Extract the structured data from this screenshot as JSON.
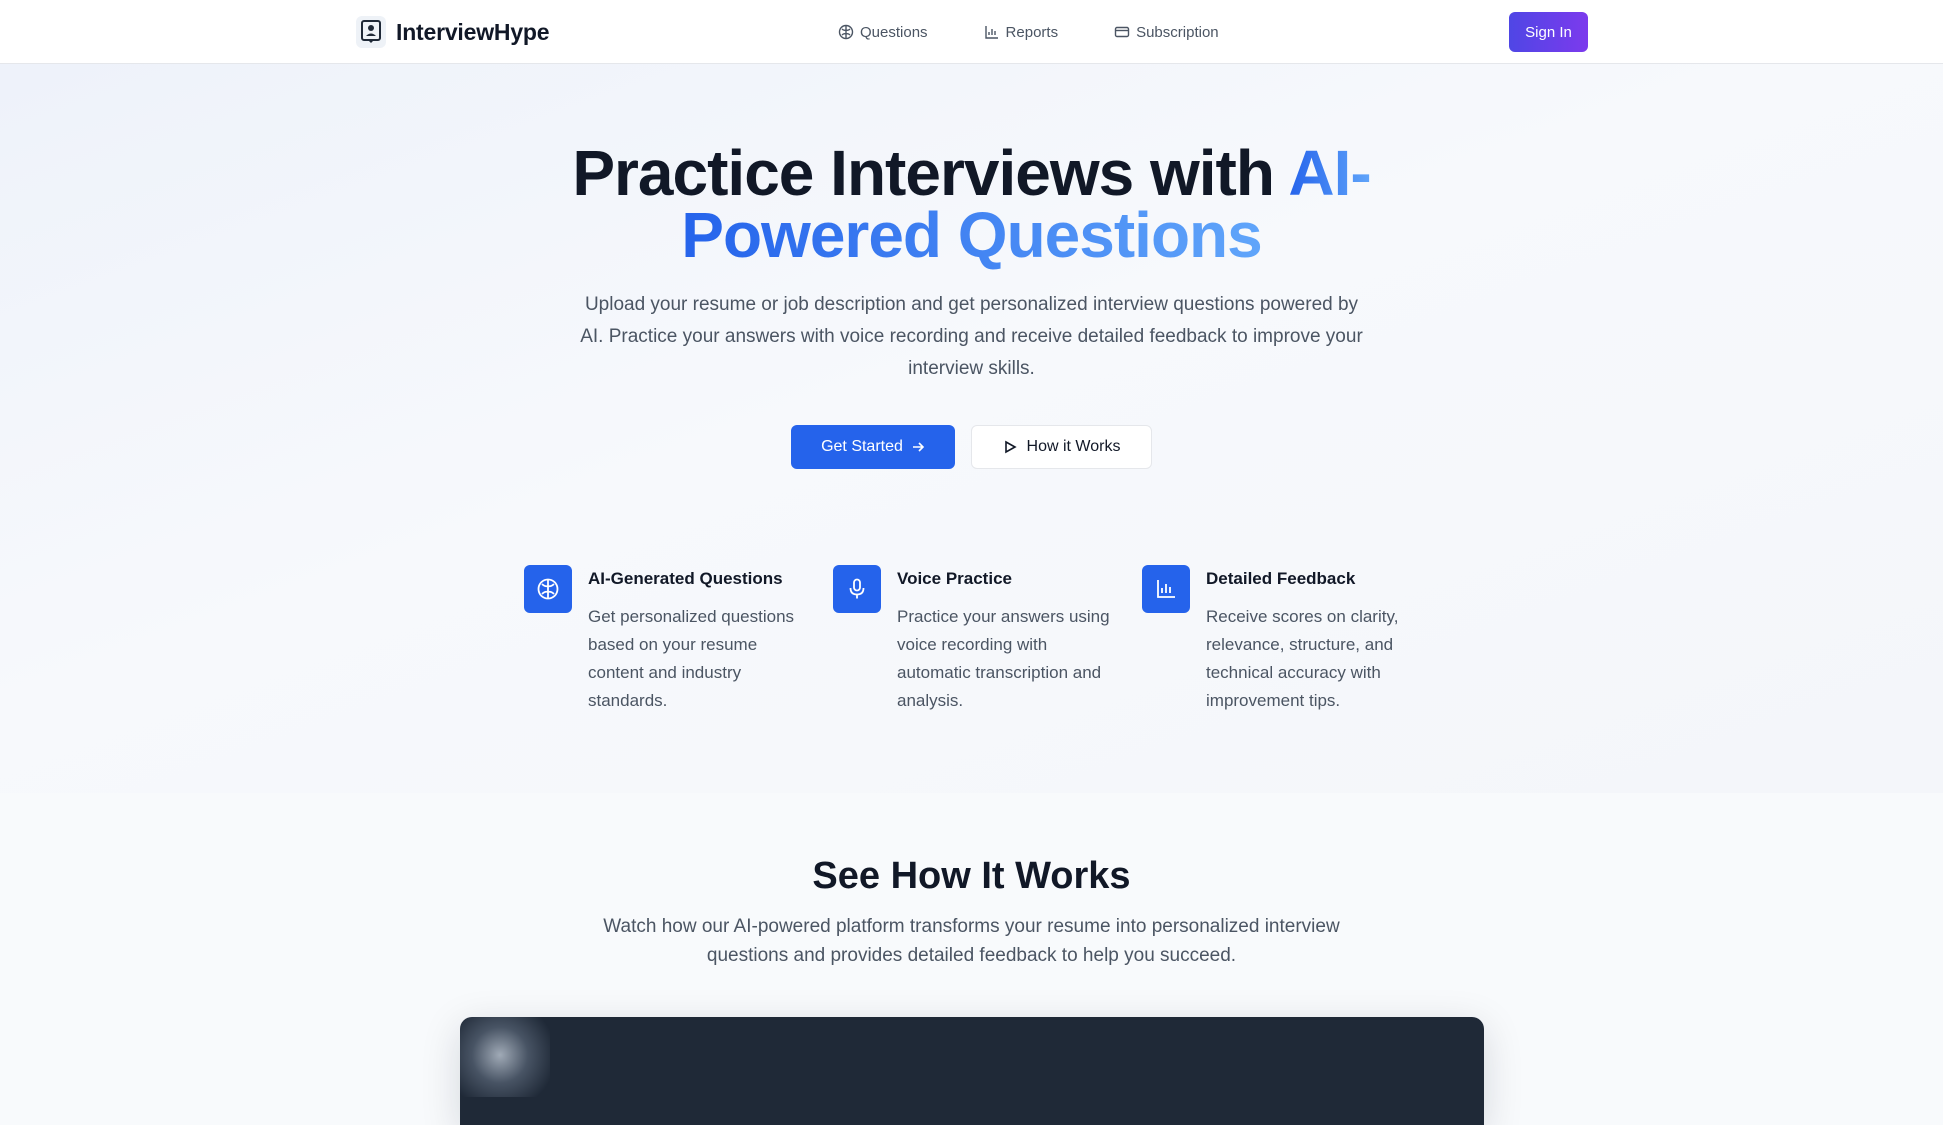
{
  "nav": {
    "brand": "InterviewHype",
    "links": [
      {
        "label": "Questions",
        "icon": "brain-icon"
      },
      {
        "label": "Reports",
        "icon": "bar-chart-icon"
      },
      {
        "label": "Subscription",
        "icon": "credit-card-icon"
      }
    ],
    "sign_in": "Sign In"
  },
  "hero": {
    "title_part1": "Practice Interviews with ",
    "title_accent_line1": "AI-",
    "title_accent_line2": "Powered Questions",
    "lead": "Upload your resume or job description and get personalized interview questions powered by AI. Practice your answers with voice recording and receive detailed feedback to improve your interview skills.",
    "primary_cta": "Get Started",
    "secondary_cta": "How it Works"
  },
  "features": [
    {
      "title": "AI-Generated Questions",
      "description": "Get personalized questions based on your resume content and industry standards.",
      "icon": "brain-icon"
    },
    {
      "title": "Voice Practice",
      "description": "Practice your answers using voice recording with automatic transcription and analysis.",
      "icon": "microphone-icon"
    },
    {
      "title": "Detailed Feedback",
      "description": "Receive scores on clarity, relevance, structure, and technical accuracy with improvement tips.",
      "icon": "bar-chart-icon"
    }
  ],
  "how_it_works": {
    "title": "See How It Works",
    "subtitle": "Watch how our AI-powered platform transforms your resume into personalized interview questions and provides detailed feedback to help you succeed."
  },
  "colors": {
    "primary": "#2563eb",
    "accent_light": "#60a5fa",
    "sign_in_gradient_start": "#4f46e5",
    "sign_in_gradient_end": "#7c3aed",
    "video_bg": "#1f2937"
  }
}
